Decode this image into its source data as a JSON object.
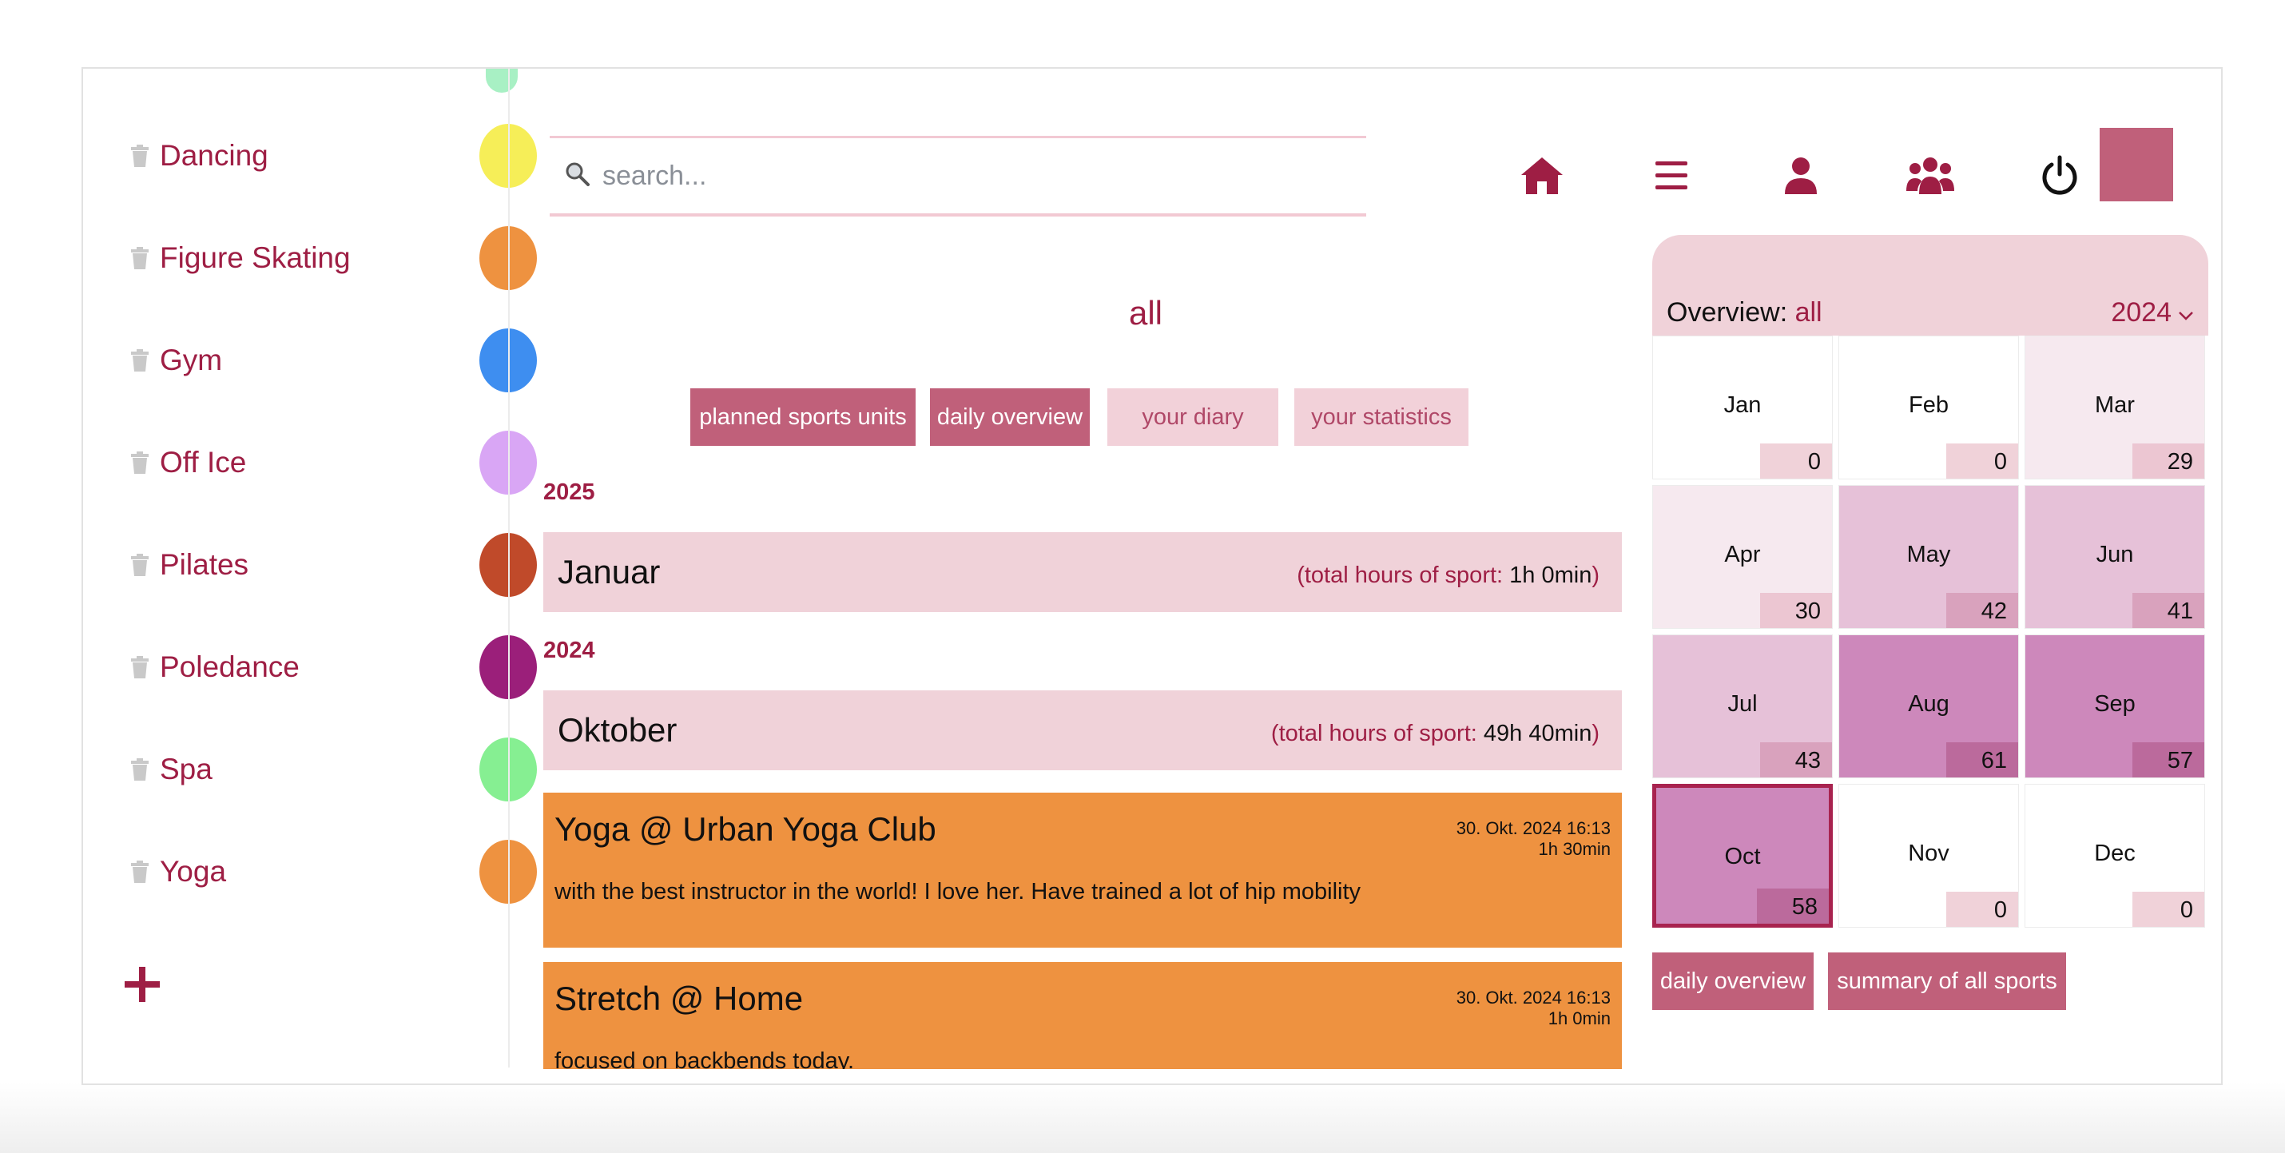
{
  "sidebar": {
    "items": [
      {
        "label": "Dancing",
        "color": "#f6ee58"
      },
      {
        "label": "Figure Skating",
        "color": "#ee9240"
      },
      {
        "label": "Gym",
        "color": "#3e8ef0"
      },
      {
        "label": "Off Ice",
        "color": "#d9a6f5"
      },
      {
        "label": "Pilates",
        "color": "#c04a2a"
      },
      {
        "label": "Poledance",
        "color": "#9b1f7a"
      },
      {
        "label": "Spa",
        "color": "#86ef92"
      },
      {
        "label": "Yoga",
        "color": "#ee9240"
      }
    ],
    "add_icon": "plus-icon",
    "item_icon": "trash-icon"
  },
  "search": {
    "placeholder": "search...",
    "value": ""
  },
  "nav": {
    "icons": [
      "home-icon",
      "menu-icon",
      "user-icon",
      "users-icon",
      "power-icon"
    ],
    "accent": "#9e1e44"
  },
  "main": {
    "filter_title": "all",
    "tabs": [
      {
        "label": "planned sports units",
        "active": true
      },
      {
        "label": "daily overview",
        "active": true
      },
      {
        "label": "your diary",
        "active": false
      },
      {
        "label": "your statistics",
        "active": false
      }
    ],
    "years": [
      {
        "year": "2025",
        "months": [
          {
            "name": "Januar",
            "total_label": "(total hours of sport: ",
            "total_value": "1h 0min",
            "total_close": ")"
          }
        ]
      },
      {
        "year": "2024",
        "months": [
          {
            "name": "Oktober",
            "total_label": "(total hours of sport: ",
            "total_value": "49h 40min",
            "total_close": ")"
          }
        ]
      }
    ],
    "entries": [
      {
        "title": "Yoga @ Urban Yoga Club",
        "date": "30. Okt. 2024 16:13",
        "duration": "1h 30min",
        "text": "with the best instructor in the world! I love her. Have trained a lot of hip mobility"
      },
      {
        "title": "Stretch @ Home",
        "date": "30. Okt. 2024 16:13",
        "duration": "1h 0min",
        "text": "focused on backbends today."
      }
    ]
  },
  "calendar": {
    "overview_label": "Overview:",
    "overview_value": "all",
    "year": "2024",
    "selected_month": "Oct",
    "months": [
      {
        "name": "Jan",
        "count": "0"
      },
      {
        "name": "Feb",
        "count": "0"
      },
      {
        "name": "Mar",
        "count": "29"
      },
      {
        "name": "Apr",
        "count": "30"
      },
      {
        "name": "May",
        "count": "42"
      },
      {
        "name": "Jun",
        "count": "41"
      },
      {
        "name": "Jul",
        "count": "43"
      },
      {
        "name": "Aug",
        "count": "61"
      },
      {
        "name": "Sep",
        "count": "57"
      },
      {
        "name": "Oct",
        "count": "58"
      },
      {
        "name": "Nov",
        "count": "0"
      },
      {
        "name": "Dec",
        "count": "0"
      }
    ],
    "buttons": [
      "daily overview",
      "summary of all sports"
    ]
  }
}
